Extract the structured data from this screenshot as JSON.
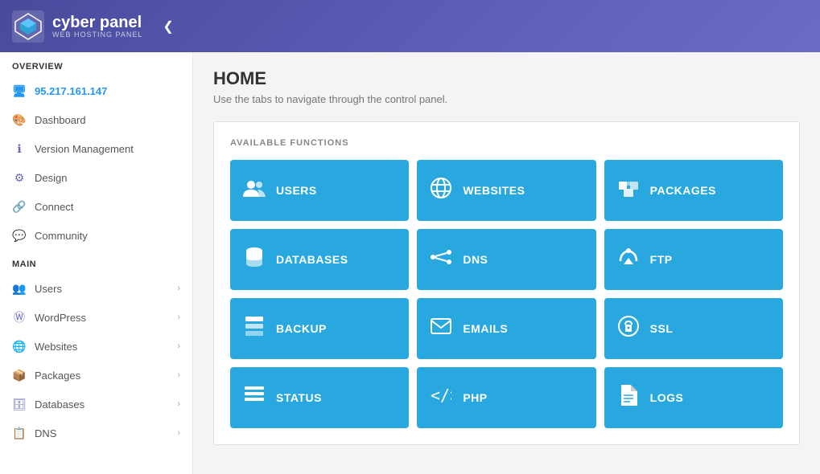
{
  "header": {
    "logo_main": "cyber panel",
    "logo_sub": "WEB HOSTING PANEL",
    "collapse_icon": "❮"
  },
  "sidebar": {
    "overview_label": "OVERVIEW",
    "ip_address": "95.217.161.147",
    "overview_items": [
      {
        "id": "dashboard",
        "label": "Dashboard",
        "icon": "🎨"
      },
      {
        "id": "version-management",
        "label": "Version Management",
        "icon": "ℹ"
      },
      {
        "id": "design",
        "label": "Design",
        "icon": "⚙"
      },
      {
        "id": "connect",
        "label": "Connect",
        "icon": "🔗"
      },
      {
        "id": "community",
        "label": "Community",
        "icon": "💬"
      }
    ],
    "main_label": "MAIN",
    "main_items": [
      {
        "id": "users",
        "label": "Users",
        "icon": "👥",
        "has_chevron": true
      },
      {
        "id": "wordpress",
        "label": "WordPress",
        "icon": "🔵",
        "has_chevron": true
      },
      {
        "id": "websites",
        "label": "Websites",
        "icon": "🌐",
        "has_chevron": true
      },
      {
        "id": "packages",
        "label": "Packages",
        "icon": "📦",
        "has_chevron": true
      },
      {
        "id": "databases",
        "label": "Databases",
        "icon": "🗄",
        "has_chevron": true
      },
      {
        "id": "dns",
        "label": "DNS",
        "icon": "📋",
        "has_chevron": true
      }
    ]
  },
  "content": {
    "page_title": "HOME",
    "page_subtitle": "Use the tabs to navigate through the control panel.",
    "functions_label": "AVAILABLE FUNCTIONS",
    "functions": [
      {
        "id": "users",
        "label": "USERS",
        "icon": "👥"
      },
      {
        "id": "websites",
        "label": "WEBSITES",
        "icon": "🌐"
      },
      {
        "id": "packages",
        "label": "PACKAGES",
        "icon": "📦"
      },
      {
        "id": "databases",
        "label": "DATABASES",
        "icon": "🗄"
      },
      {
        "id": "dns",
        "label": "DNS",
        "icon": "🔀"
      },
      {
        "id": "ftp",
        "label": "FTP",
        "icon": "☁"
      },
      {
        "id": "backup",
        "label": "BACKUP",
        "icon": "📋"
      },
      {
        "id": "emails",
        "label": "EMAILS",
        "icon": "✉"
      },
      {
        "id": "ssl",
        "label": "SSL",
        "icon": "🔒"
      },
      {
        "id": "status",
        "label": "STATUS",
        "icon": "☰"
      },
      {
        "id": "php",
        "label": "PHP",
        "icon": "⟨/⟩"
      },
      {
        "id": "logs",
        "label": "LOGS",
        "icon": "📄"
      }
    ]
  }
}
